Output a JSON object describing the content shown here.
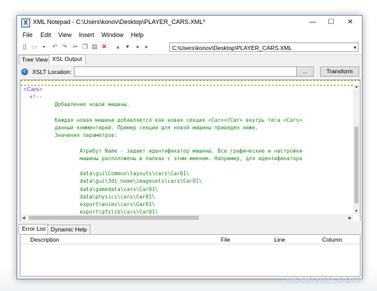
{
  "window": {
    "icon_glyph": "X",
    "title": "XML Notepad - C:\\Users\\konov\\Desktop\\PLAYER_CARS.XML*",
    "minimize": "—",
    "maximize": "☐",
    "close": "✕"
  },
  "menu": [
    "File",
    "Edit",
    "View",
    "Insert",
    "Window",
    "Help"
  ],
  "toolbar": {
    "icons": [
      "new-icon",
      "open-icon",
      "save-icon",
      "undo-icon",
      "redo-icon",
      "cut-icon",
      "copy-icon",
      "paste-icon",
      "delete-icon",
      "nudge-up-icon",
      "nudge-down-icon",
      "nudge-left-icon",
      "nudge-right-icon"
    ],
    "glyphs": [
      "▯",
      "▭",
      "▪",
      "↶",
      "↷",
      "✂",
      "❐",
      "▤",
      "✕",
      "▴",
      "▾",
      "◂",
      "▸"
    ],
    "path_value": "C:\\Users\\konov\\Desktop\\PLAYER_CARS.XML",
    "path_arrow": "▾"
  },
  "tabs_top": [
    "Tree View",
    "XSL Output"
  ],
  "xslt": {
    "icon_glyph": "e",
    "label": "XSLT Location:",
    "value": "",
    "browse": "...",
    "transform": "Transform"
  },
  "output": {
    "lines": [
      {
        "kind": "tag",
        "text": "<Cars>"
      },
      {
        "kind": "cmt",
        "text": "  <!--"
      },
      {
        "kind": "txt",
        "text": "          Добавление новой машины."
      },
      {
        "kind": "txt",
        "text": ""
      },
      {
        "kind": "txt",
        "text": "          Каждая новая машина добавляется как новая секция <Car></Car> внутрь тега <Cars>"
      },
      {
        "kind": "txt",
        "text": "          данный комментарий. Пример секции для новой машины приведен ниже."
      },
      {
        "kind": "txt",
        "text": "          Значения параметров:"
      },
      {
        "kind": "txt",
        "text": ""
      },
      {
        "kind": "txt",
        "text": "                  Атрибут Name - задает идентификатор машины. Все графические и настройки"
      },
      {
        "kind": "txt",
        "text": "                  машины расположены в папках с этим именем. Например, для идентификатора"
      },
      {
        "kind": "txt",
        "text": ""
      },
      {
        "kind": "txt",
        "text": "                  data\\gui\\Common\\layouts\\cars\\Car01\\"
      },
      {
        "kind": "txt",
        "text": "                  data\\gui\\3di_home\\imagesets\\cars\\Car01\\"
      },
      {
        "kind": "txt",
        "text": "                  data\\gamedata\\cars\\Car01\\"
      },
      {
        "kind": "txt",
        "text": "                  data\\physics\\cars\\Car01\\"
      },
      {
        "kind": "txt",
        "text": "                  export\\anims\\cars\\Car01\\"
      },
      {
        "kind": "txt",
        "text": "                  export\\gfxlib\\cars\\Car01\\"
      }
    ]
  },
  "tabs_bottom": [
    "Error List",
    "Dynamic Help"
  ],
  "error_list": {
    "columns": [
      "Description",
      "File",
      "Line",
      "Column"
    ]
  },
  "watermark": "user-life.com"
}
